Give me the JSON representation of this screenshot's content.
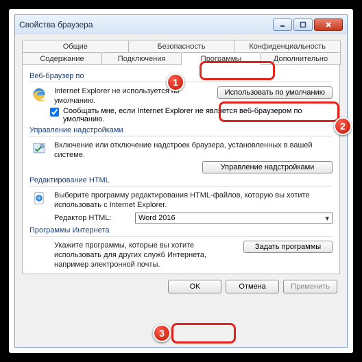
{
  "window": {
    "title": "Свойства браузера"
  },
  "tabs": {
    "row1": [
      "Общие",
      "Безопасность",
      "Конфиденциальность"
    ],
    "row2": [
      "Содержание",
      "Подключения",
      "Программы",
      "Дополнительно"
    ],
    "selected": "Программы"
  },
  "defaultBrowser": {
    "group": "Веб-браузер по",
    "text": "Internet Explorer не используется по умолчанию.",
    "button": "Использовать по умолчанию",
    "checkbox": "Сообщать мне, если Internet Explorer не является веб-браузером по умолчанию."
  },
  "addons": {
    "group": "Управление надстройками",
    "text": "Включение или отключение надстроек браузера, установленных в вашей системе.",
    "button": "Управление надстройками"
  },
  "htmlEdit": {
    "group": "Редактирование HTML",
    "text": "Выберите программу редактирования HTML-файлов, которую вы хотите использовать с Internet Explorer.",
    "label": "Редактор HTML:",
    "value": "Word 2016"
  },
  "internetPrograms": {
    "group": "Программы Интернета",
    "text": "Укажите программы, которые вы хотите использовать для других служб Интернета, например электронной почты.",
    "button": "Задать программы"
  },
  "footer": {
    "ok": "ОК",
    "cancel": "Отмена",
    "apply": "Применить"
  },
  "badges": {
    "b1": "1",
    "b2": "2",
    "b3": "3"
  }
}
